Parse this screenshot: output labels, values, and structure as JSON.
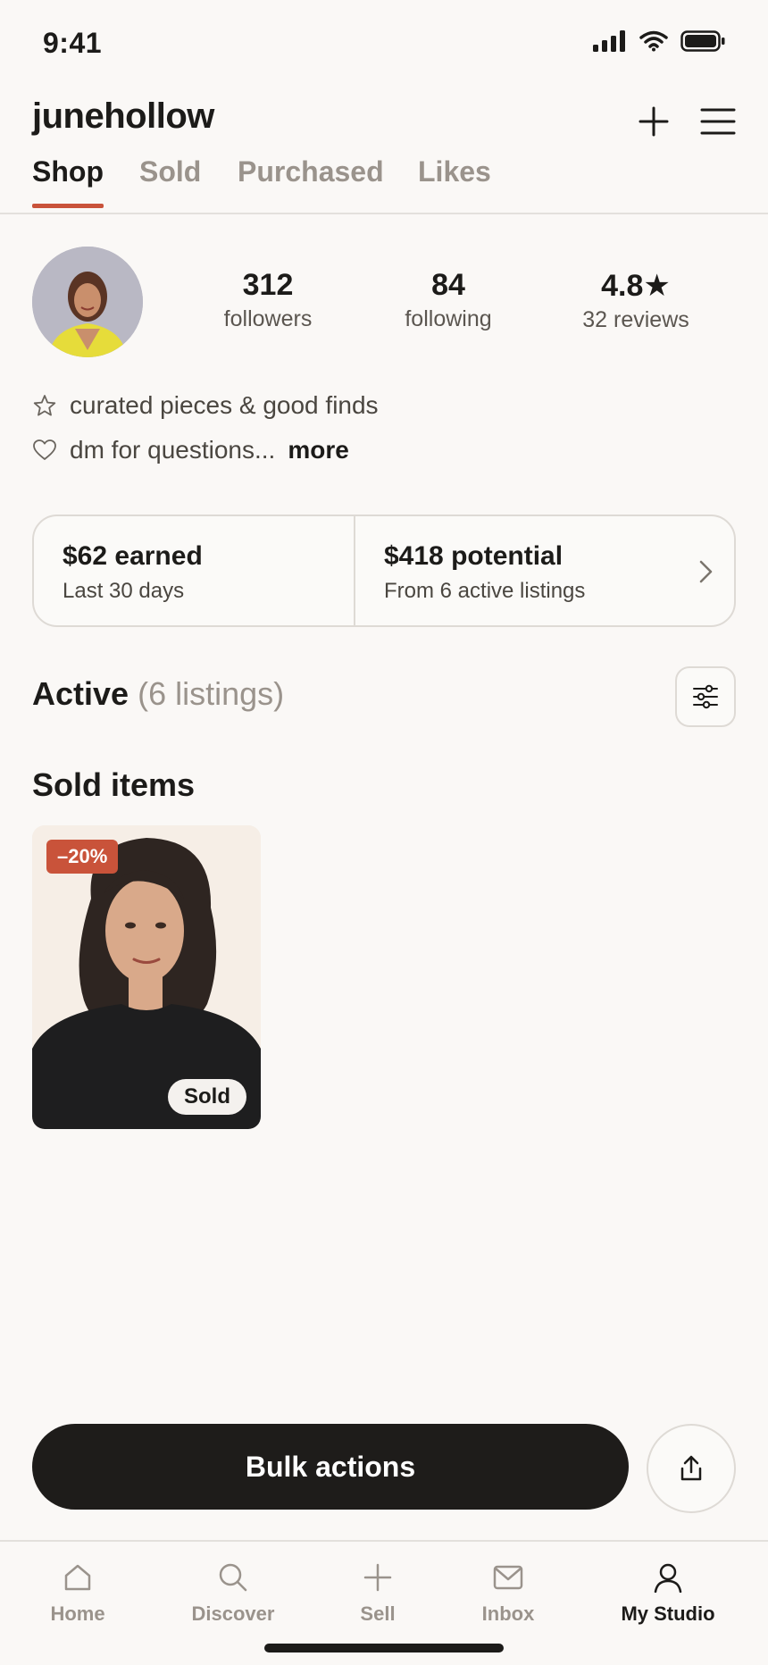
{
  "status_bar": {
    "time": "9:41"
  },
  "header": {
    "username": "junehollow",
    "add_icon": "plus-icon",
    "menu_icon": "hamburger-icon"
  },
  "tabs": [
    {
      "label": "Shop",
      "active": true
    },
    {
      "label": "Sold",
      "active": false
    },
    {
      "label": "Purchased",
      "active": false
    },
    {
      "label": "Likes",
      "active": false
    }
  ],
  "profile": {
    "stats": [
      {
        "value": "312",
        "label": "followers"
      },
      {
        "value": "84",
        "label": "following"
      },
      {
        "value": "4.8★",
        "label": "32 reviews"
      }
    ],
    "bio": [
      {
        "icon": "star-outline-icon",
        "text": "curated pieces & good finds"
      },
      {
        "icon": "heart-outline-icon",
        "text": "dm for questions..."
      }
    ],
    "more_label": "more"
  },
  "earnings": {
    "earned_title": "$62 earned",
    "earned_sub": "Last 30 days",
    "potential_title": "$418 potential",
    "potential_sub": "From 6 active listings"
  },
  "active_section": {
    "title": "Active",
    "count": "(6 listings)"
  },
  "sold_section": {
    "title": "Sold items",
    "items": [
      {
        "discount": "–20%",
        "status": "Sold"
      }
    ]
  },
  "actions": {
    "bulk_label": "Bulk actions",
    "share_icon": "share-icon"
  },
  "bottom_nav": [
    {
      "label": "Home",
      "icon": "home-icon",
      "active": false
    },
    {
      "label": "Discover",
      "icon": "search-icon",
      "active": false
    },
    {
      "label": "Sell",
      "icon": "plus-icon",
      "active": false
    },
    {
      "label": "Inbox",
      "icon": "mail-icon",
      "active": false
    },
    {
      "label": "My Studio",
      "icon": "user-icon",
      "active": true
    }
  ],
  "colors": {
    "accent": "#c9533a",
    "background": "#faf8f6",
    "text": "#1c1b19",
    "muted": "#9a938c"
  }
}
